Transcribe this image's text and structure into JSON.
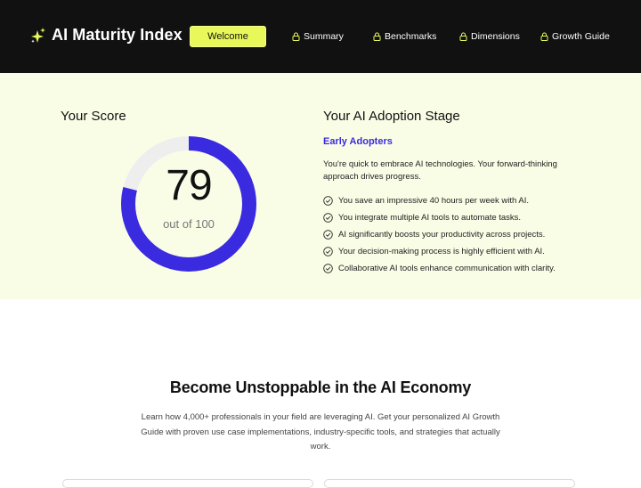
{
  "header": {
    "brand_title": "AI Maturity Index",
    "brand_icon": "sparkles-icon",
    "accent_color": "#e8f85a",
    "welcome_label": "Welcome",
    "nav_items": [
      {
        "label": "Summary",
        "icon": "lock-icon"
      },
      {
        "label": "Benchmarks",
        "icon": "lock-icon"
      },
      {
        "label": "Dimensions",
        "icon": "lock-icon"
      },
      {
        "label": "Growth Guide",
        "icon": "lock-icon"
      }
    ]
  },
  "score": {
    "heading": "Your Score",
    "value": "79",
    "caption": "out of 100",
    "fraction": 0.79,
    "ring_color": "#3a2ae0",
    "track_color": "#eeeeee"
  },
  "stage": {
    "heading": "Your AI Adoption Stage",
    "name": "Early Adopters",
    "description": "You're quick to embrace AI technologies. Your forward-thinking approach drives progress.",
    "benefits": [
      "You save an impressive 40 hours per week with AI.",
      "You integrate multiple AI tools to automate tasks.",
      "AI significantly boosts your productivity across projects.",
      "Your decision-making process is highly efficient with AI.",
      "Collaborative AI tools enhance communication with clarity."
    ]
  },
  "cta": {
    "title": "Become Unstoppable in the AI Economy",
    "description": "Learn how 4,000+ professionals in your field are leveraging AI. Get your personalized AI Growth Guide with proven use case implementations, industry-specific tools, and strategies that actually work."
  }
}
